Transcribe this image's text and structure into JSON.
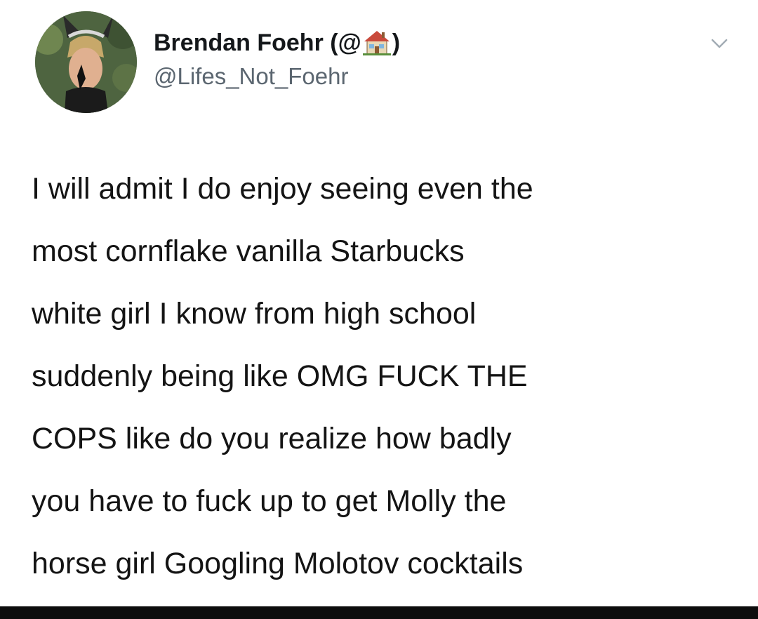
{
  "tweet": {
    "display_name_prefix": "Brendan Foehr (@",
    "display_name_suffix": ")",
    "display_name_emoji": "house-icon",
    "handle": "@Lifes_Not_Foehr",
    "menu_icon": "chevron-down-icon",
    "text_lines": [
      "I will admit I do enjoy seeing even the",
      "most cornflake vanilla Starbucks",
      "white girl I know from high school",
      "suddenly being like OMG FUCK THE",
      "COPS like do you realize how badly",
      "you have to fuck up to get Molly the",
      "horse girl Googling Molotov cocktails"
    ]
  },
  "colors": {
    "text": "#141414",
    "handle": "#5b6670",
    "chevron": "#a3adb5",
    "bottom_bar": "#0d0d0d"
  }
}
